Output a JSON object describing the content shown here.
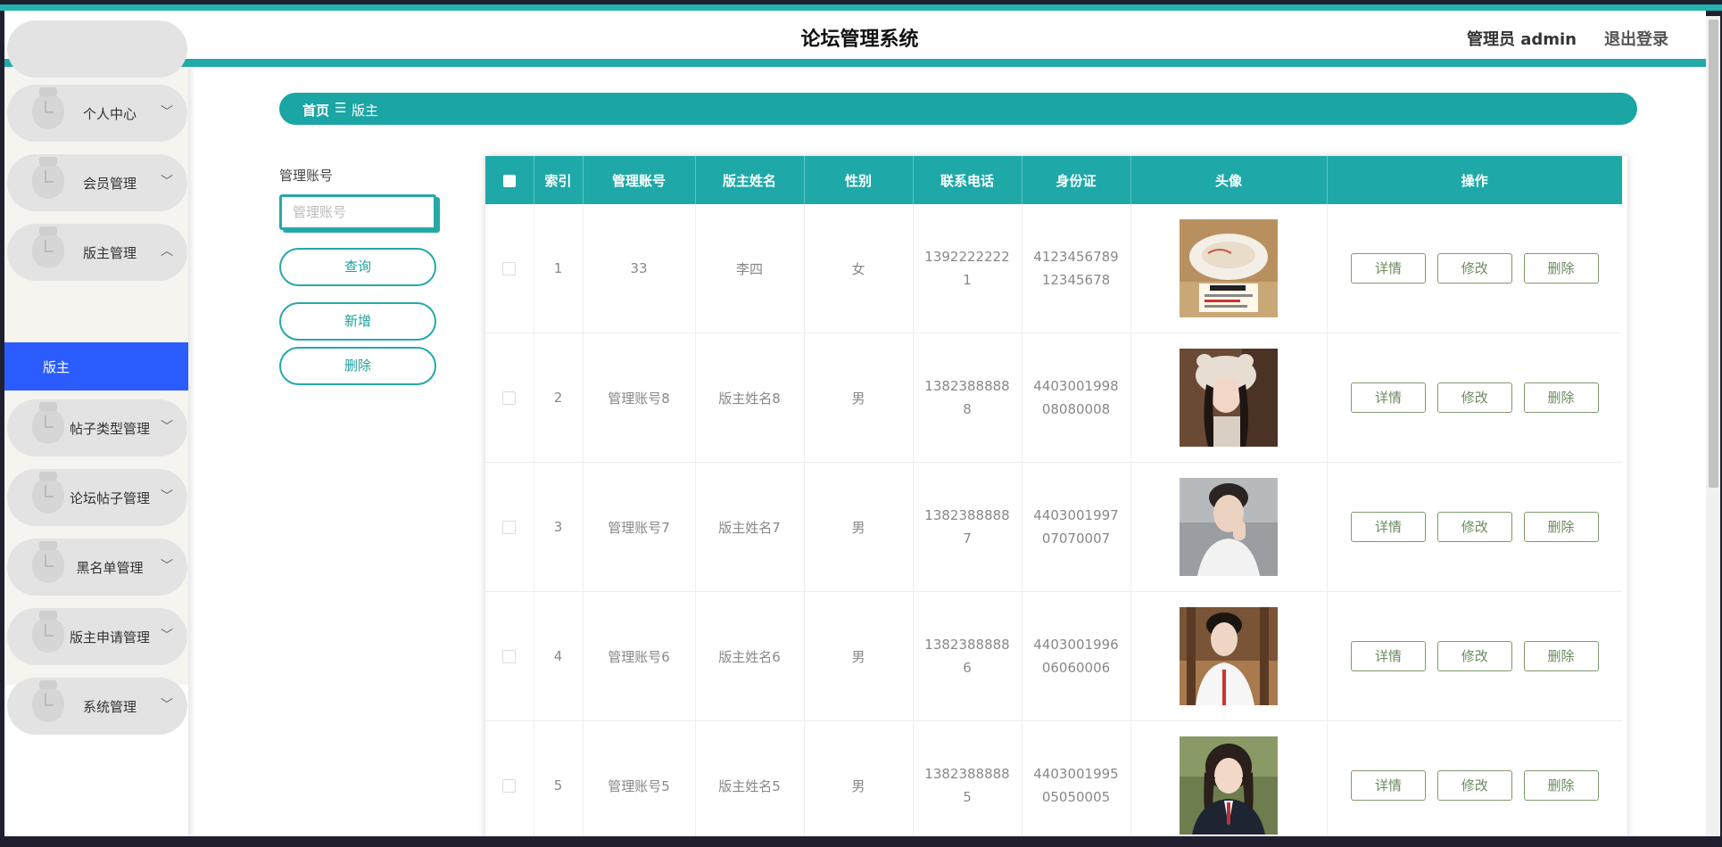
{
  "header": {
    "title": "论坛管理系统",
    "admin": "管理员 admin",
    "logout": "退出登录"
  },
  "sidebar": {
    "items": [
      {
        "label": "个人中心",
        "chevron": "﹀"
      },
      {
        "label": "会员管理",
        "chevron": "﹀"
      },
      {
        "label": "版主管理",
        "chevron": "︿"
      },
      {
        "label": "帖子类型管理",
        "chevron": "﹀"
      },
      {
        "label": "论坛帖子管理",
        "chevron": "﹀"
      },
      {
        "label": "黑名单管理",
        "chevron": "﹀"
      },
      {
        "label": "版主申请管理",
        "chevron": "﹀"
      },
      {
        "label": "系统管理",
        "chevron": "﹀"
      }
    ],
    "active_sub": "版主",
    "icon": "folder-icon"
  },
  "breadcrumb": {
    "home": "首页",
    "separator": "☰",
    "current": "版主"
  },
  "search": {
    "label": "管理账号",
    "placeholder": "管理账号",
    "query_label": "查询",
    "add_label": "新增",
    "delete_label": "删除"
  },
  "table": {
    "headers": [
      "索引",
      "管理账号",
      "版主姓名",
      "性别",
      "联系电话",
      "身份证",
      "头像",
      "操作"
    ],
    "actions": {
      "detail": "详情",
      "edit": "修改",
      "delete": "删除"
    },
    "rows": [
      {
        "index": "1",
        "account": "33",
        "name": "李四",
        "gender": "女",
        "phone": "13922222221",
        "idcard": "412345678912345678",
        "avatar": "ceiling-lamp-photo"
      },
      {
        "index": "2",
        "account": "管理账号8",
        "name": "版主姓名8",
        "gender": "男",
        "phone": "13823888888",
        "idcard": "440300199808080008",
        "avatar": "girl-bear-hat-photo"
      },
      {
        "index": "3",
        "account": "管理账号7",
        "name": "版主姓名7",
        "gender": "男",
        "phone": "13823888887",
        "idcard": "440300199707070007",
        "avatar": "young-man-photo"
      },
      {
        "index": "4",
        "account": "管理账号6",
        "name": "版主姓名6",
        "gender": "男",
        "phone": "13823888886",
        "idcard": "440300199606060006",
        "avatar": "man-in-cafe-photo"
      },
      {
        "index": "5",
        "account": "管理账号5",
        "name": "版主姓名5",
        "gender": "男",
        "phone": "13823888885",
        "idcard": "440300199505050005",
        "avatar": "girl-uniform-photo"
      }
    ]
  },
  "colors": {
    "accent": "#1ea9a8",
    "active_sub": "#2b5cff",
    "action_border": "#7e9a6e"
  }
}
